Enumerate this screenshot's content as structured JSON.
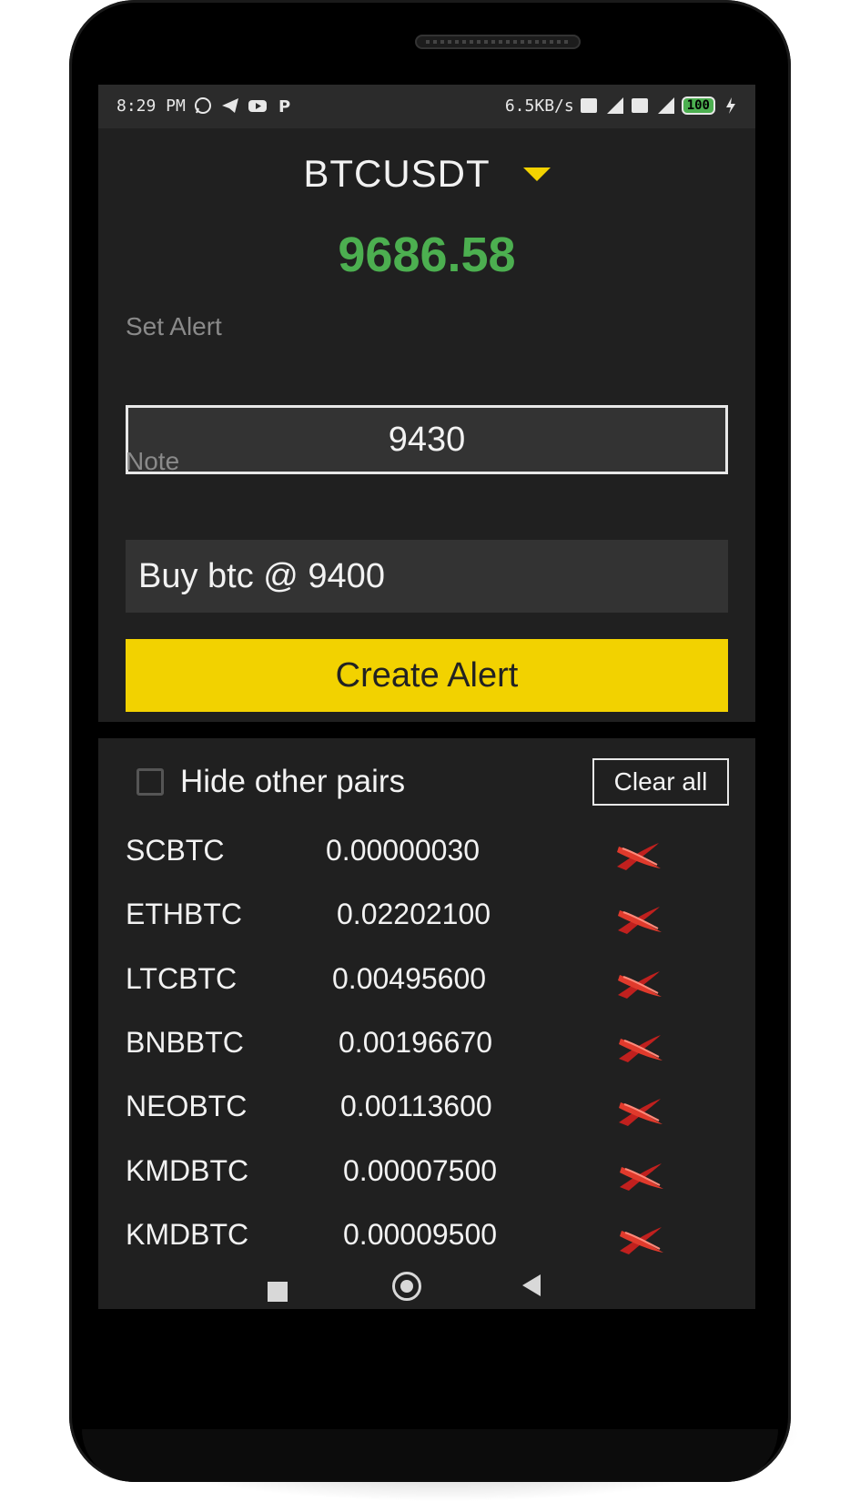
{
  "status_bar": {
    "time": "8:29 PM",
    "net_speed": "6.5KB/s",
    "battery": "100"
  },
  "header": {
    "pair": "BTCUSDT",
    "price": "9686.58",
    "price_color": "#4caf50"
  },
  "form": {
    "set_alert_label": "Set Alert",
    "alert_value": "9430",
    "note_label": "Note",
    "note_value": "Buy btc @ 9400",
    "create_label": "Create Alert",
    "accent": "#f2d200"
  },
  "alerts": {
    "hide_label": "Hide other pairs",
    "hide_checked": false,
    "clear_label": "Clear all",
    "items": [
      {
        "symbol": "SCBTC",
        "value": "0.00000030"
      },
      {
        "symbol": "ETHBTC",
        "value": "0.02202100"
      },
      {
        "symbol": "LTCBTC",
        "value": "0.00495600"
      },
      {
        "symbol": "BNBBTC",
        "value": "0.00196670"
      },
      {
        "symbol": "NEOBTC",
        "value": "0.00113600"
      },
      {
        "symbol": "KMDBTC",
        "value": "0.00007500"
      },
      {
        "symbol": "KMDBTC",
        "value": "0.00009500"
      }
    ],
    "delete_icon": "red-x-icon"
  },
  "nav": {
    "icons": [
      "recents-icon",
      "home-icon",
      "back-icon"
    ]
  }
}
